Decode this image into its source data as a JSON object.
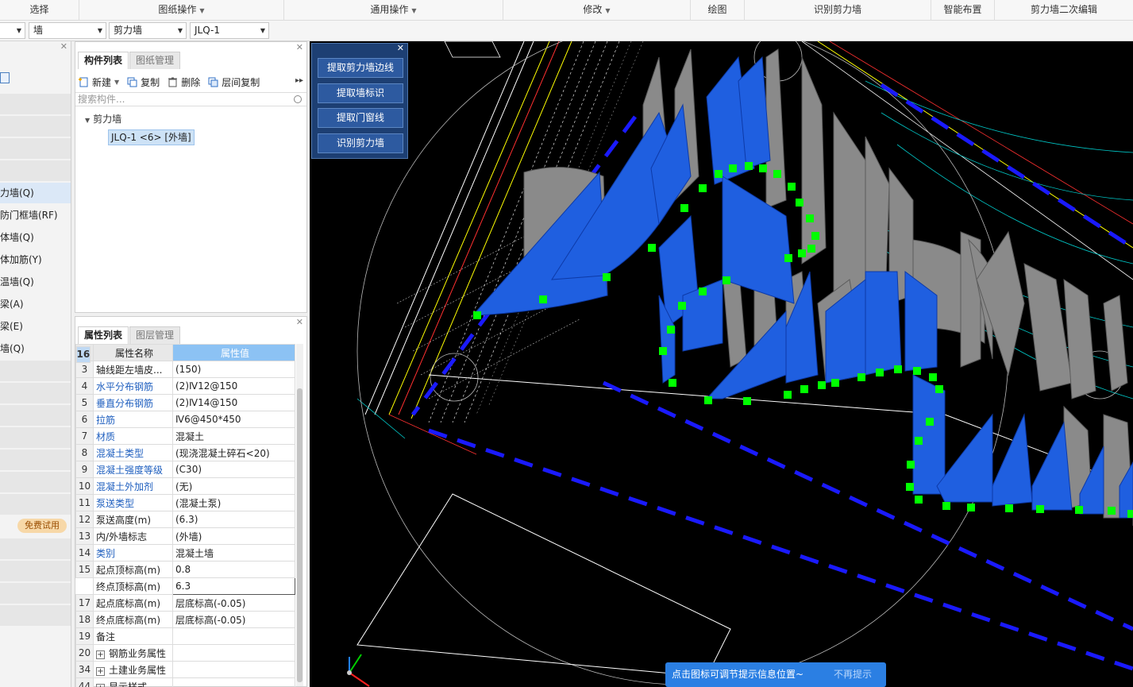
{
  "ribbon": {
    "groups": [
      {
        "label": "选择",
        "dropdown": false
      },
      {
        "label": "图纸操作",
        "dropdown": true
      },
      {
        "label": "通用操作",
        "dropdown": true
      },
      {
        "label": "修改",
        "dropdown": true
      },
      {
        "label": "绘图",
        "dropdown": false
      },
      {
        "label": "识别剪力墙",
        "dropdown": false
      },
      {
        "label": "智能布置",
        "dropdown": false
      },
      {
        "label": "剪力墙二次编辑",
        "dropdown": false
      }
    ]
  },
  "selectors": {
    "floor": "",
    "category": "墙",
    "type": "剪力墙",
    "component": "JLQ-1"
  },
  "left_nav": {
    "items": [
      "力墙(Q)",
      "防门框墙(RF)",
      "体墙(Q)",
      "体加筋(Y)",
      "温墙(Q)",
      "梁(A)",
      "梁(E)",
      "墙(Q)"
    ],
    "trial_badge": "免费试用"
  },
  "component_list": {
    "tabs": [
      "构件列表",
      "图纸管理"
    ],
    "toolbar": {
      "new": "新建",
      "copy": "复制",
      "delete": "删除",
      "floor_copy": "层间复制"
    },
    "search_placeholder": "搜索构件...",
    "tree": {
      "root": "剪力墙",
      "item": "JLQ-1 <6> [外墙]"
    }
  },
  "properties": {
    "tabs": [
      "属性列表",
      "图层管理"
    ],
    "headers": {
      "name": "属性名称",
      "value": "属性值"
    },
    "rows": [
      {
        "num": "3",
        "name": "轴线距左墙皮...",
        "value": "(150)",
        "link": false
      },
      {
        "num": "4",
        "name": "水平分布钢筋",
        "value": "(2)Ⅳ12@150",
        "link": true
      },
      {
        "num": "5",
        "name": "垂直分布钢筋",
        "value": "(2)Ⅳ14@150",
        "link": true
      },
      {
        "num": "6",
        "name": "拉筋",
        "value": "Ⅳ6@450*450",
        "link": true
      },
      {
        "num": "7",
        "name": "材质",
        "value": "混凝土",
        "link": true
      },
      {
        "num": "8",
        "name": "混凝土类型",
        "value": "(现浇混凝土碎石<20)",
        "link": true
      },
      {
        "num": "9",
        "name": "混凝土强度等级",
        "value": "(C30)",
        "link": true
      },
      {
        "num": "10",
        "name": "混凝土外加剂",
        "value": "(无)",
        "link": true
      },
      {
        "num": "11",
        "name": "泵送类型",
        "value": "(混凝土泵)",
        "link": true
      },
      {
        "num": "12",
        "name": "泵送高度(m)",
        "value": "(6.3)",
        "link": false
      },
      {
        "num": "13",
        "name": "内/外墙标志",
        "value": "(外墙)",
        "link": false
      },
      {
        "num": "14",
        "name": "类别",
        "value": "混凝土墙",
        "link": true
      },
      {
        "num": "15",
        "name": "起点顶标高(m)",
        "value": "0.8",
        "link": false
      },
      {
        "num": "16",
        "name": "终点顶标高(m)",
        "value": "6.3",
        "link": false
      },
      {
        "num": "17",
        "name": "起点底标高(m)",
        "value": "层底标高(-0.05)",
        "link": false
      },
      {
        "num": "18",
        "name": "终点底标高(m)",
        "value": "层底标高(-0.05)",
        "link": false
      },
      {
        "num": "19",
        "name": "备注",
        "value": "",
        "link": false
      },
      {
        "num": "20",
        "name": "钢筋业务属性",
        "value": "",
        "link": false
      },
      {
        "num": "34",
        "name": "土建业务属性",
        "value": "",
        "link": false
      },
      {
        "num": "44",
        "name": "显示样式",
        "value": "",
        "link": false
      }
    ]
  },
  "identify_panel": {
    "buttons": [
      "提取剪力墙边线",
      "提取墙标识",
      "提取门窗线",
      "识别剪力墙"
    ]
  },
  "tip": {
    "message": "点击图标可调节提示信息位置~",
    "dismiss": "不再提示"
  },
  "colors": {
    "wall_blue": "#1f5fe0",
    "wall_gray": "#8a8a8a",
    "grip_green": "#00ff00",
    "tip_blue": "#2b7fe3",
    "header_blue": "#8cc2f4"
  }
}
